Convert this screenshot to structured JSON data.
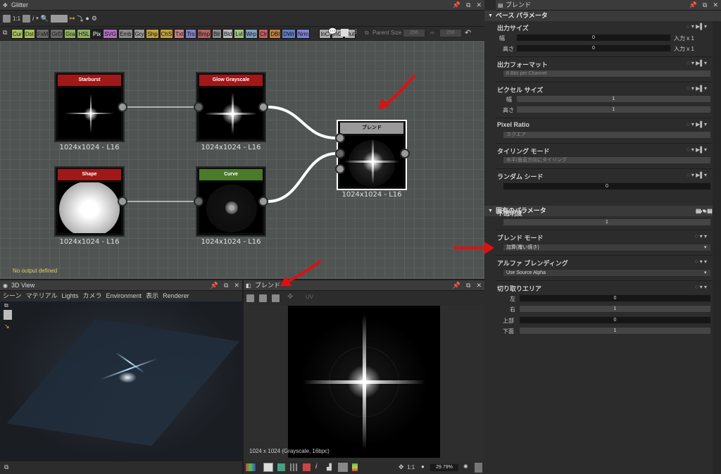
{
  "graph_window": {
    "title": "Glitter",
    "zoom_label": "1:1"
  },
  "node_buttons": [
    {
      "label": "Cur",
      "color": "#a8c060"
    },
    {
      "label": "Dst",
      "color": "#a8c060"
    },
    {
      "label": "FxM",
      "color": "#6a6a6a"
    },
    {
      "label": "GrD",
      "color": "#6a6a6a"
    },
    {
      "label": "Gra",
      "color": "#8fb060"
    },
    {
      "label": "HSL",
      "color": "#8fb060"
    },
    {
      "label": "Pix",
      "color": "#222222"
    },
    {
      "label": "SVG",
      "color": "#b070c0"
    },
    {
      "label": "Emb",
      "color": "#8a8a8a"
    },
    {
      "label": "Gry",
      "color": "#9a9a9a"
    },
    {
      "label": "Shp",
      "color": "#c0a040"
    },
    {
      "label": "ChS",
      "color": "#c0a040"
    },
    {
      "label": "Txt",
      "color": "#c08080"
    },
    {
      "label": "Trs",
      "color": "#8080c0"
    },
    {
      "label": "Bmp",
      "color": "#b06060"
    },
    {
      "label": "Blr",
      "color": "#8a8a8a"
    },
    {
      "label": "Bld",
      "color": "#bbbbbb"
    },
    {
      "label": "Lvl",
      "color": "#a0c080"
    },
    {
      "label": "Wrp",
      "color": "#80a0c0"
    },
    {
      "label": "Clr",
      "color": "#c06060"
    },
    {
      "label": "DBl",
      "color": "#c08040"
    },
    {
      "label": "DWr",
      "color": "#6080c0"
    },
    {
      "label": "Nrm",
      "color": "#8080d0"
    },
    {
      "label": "InC",
      "color": "#aaaaaa"
    },
    {
      "label": "InG",
      "color": "#aaaaaa"
    },
    {
      "label": "Out",
      "color": "#aaaaaa"
    }
  ],
  "parent_size": {
    "label": "Parent Size",
    "w": "256",
    "h": "256"
  },
  "nodes": {
    "starburst": {
      "title": "Starburst",
      "size": "1024x1024 - L16",
      "color": "#a01818"
    },
    "glow": {
      "title": "Glow Grayscale",
      "size": "1024x1024 - L16",
      "color": "#a01818"
    },
    "blend": {
      "title": "ブレンド",
      "size": "1024x1024 - L16",
      "color": "#9a9a9a"
    },
    "shape": {
      "title": "Shape",
      "size": "1024x1024 - L16",
      "color": "#a01818"
    },
    "curve": {
      "title": "Curve",
      "size": "1024x1024 - L16",
      "color": "#4a7a2a"
    }
  },
  "no_output": "No output defined",
  "view3d": {
    "title": "3D View",
    "menu": [
      "シーン",
      "マテリアル",
      "Lights",
      "カメラ",
      "Environment",
      "表示",
      "Renderer"
    ]
  },
  "preview": {
    "title": "ブレンド",
    "uv_label": "UV",
    "info": "1024 x 1024 (Grayscale, 16bpc)",
    "zoom_ratio": "1:1",
    "zoom_pct": "29.79%"
  },
  "props": {
    "title": "ブレンド",
    "base_section": "ベース パラメータ",
    "output_size": {
      "label": "出力サイズ",
      "w_label": "幅",
      "h_label": "高さ",
      "w_val": "0",
      "h_val": "0",
      "w_suffix": "入力 x 1",
      "h_suffix": "入力 x 1"
    },
    "output_format": {
      "label": "出力フォーマット",
      "value": "8 Bits per Channel"
    },
    "pixel_size": {
      "label": "ピクセル サイズ",
      "w_label": "幅",
      "h_label": "高さ",
      "w_val": "1",
      "h_val": "1"
    },
    "pixel_ratio": {
      "label": "Pixel Ratio",
      "value": "スクエア"
    },
    "tiling": {
      "label": "タイリング モード",
      "value": "水平/垂直方向にタイリング"
    },
    "seed": {
      "label": "ランダム シード",
      "value": "0"
    },
    "specific_section": "固有のパラメータ",
    "opacity": {
      "label": "不透明度",
      "value": "1"
    },
    "blend_mode": {
      "label": "ブレンド モード",
      "value": "加算(覆い焼き)"
    },
    "alpha_blend": {
      "label": "アルファ ブレンディング",
      "value": "Use Source Alpha"
    },
    "crop": {
      "label": "切り取りエリア",
      "left_label": "左",
      "right_label": "右",
      "top_label": "上部",
      "bottom_label": "下面",
      "left": "0",
      "right": "1",
      "top": "0",
      "bottom": "1"
    }
  },
  "colors": {
    "accent": "#cc2222",
    "arrow": "#dd1111"
  }
}
